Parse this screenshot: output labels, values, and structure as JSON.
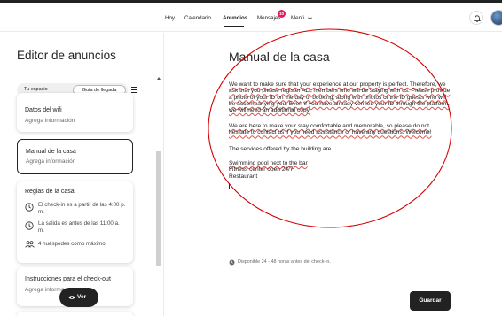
{
  "nav": {
    "links": [
      "Hoy",
      "Calendario",
      "Anuncios",
      "Mensajes",
      "Menú"
    ],
    "active": "Anuncios",
    "messages_badge": "10",
    "menu_chevron": "chevron-down-icon",
    "bell_icon": "bell-icon",
    "avatar": "user-avatar"
  },
  "sidebar": {
    "title": "Editor de anuncios",
    "tabs": [
      "Tu espacio",
      "Guía de llegada"
    ],
    "active_tab": "Guía de llegada",
    "cards": [
      {
        "title": "Datos del wifi",
        "subtitle": "Agrega información"
      },
      {
        "title": "Manual de la casa",
        "subtitle": "Agrega información",
        "selected": true
      },
      {
        "title": "Reglas de la casa",
        "rules": [
          {
            "icon": "clock-icon",
            "text": "El check-in es a partir de las 4:00 p. m."
          },
          {
            "icon": "clock-icon",
            "text": "La salida es antes de las 11:00 a. m."
          },
          {
            "icon": "guests-icon",
            "text": "4 huéspedes como máximo"
          }
        ]
      },
      {
        "title": "Instrucciones para el check-out",
        "subtitle": "Agrega informac"
      }
    ],
    "preview_button": "Ver"
  },
  "main": {
    "title": "Manual de la casa",
    "paragraphs": [
      "We want to make sure that your experience at our property is perfect. Therefore, we ask that you please register ALL members who will be staying with us. Please provide a photo of your ID on the day of booking, along with photos of the ID guests who will be accompanying you. Even if you have already verified your ID through the platform, we will need an additional copy.",
      "We are here to make your stay comfortable and memorable, so please do not hesitate to contact us if you need assistance or have any questions. Welcome!",
      "The services offered by the building are",
      "Swimming pool next to the bar",
      "Fitness center open 24/7",
      "Restaurant"
    ],
    "availability": "Disponible 24 - 48 horas antes del check-in.",
    "save_button": "Guardar"
  },
  "colors": {
    "accent": "#e31c5f",
    "annotation": "#d40000",
    "primary_button": "#222222"
  }
}
